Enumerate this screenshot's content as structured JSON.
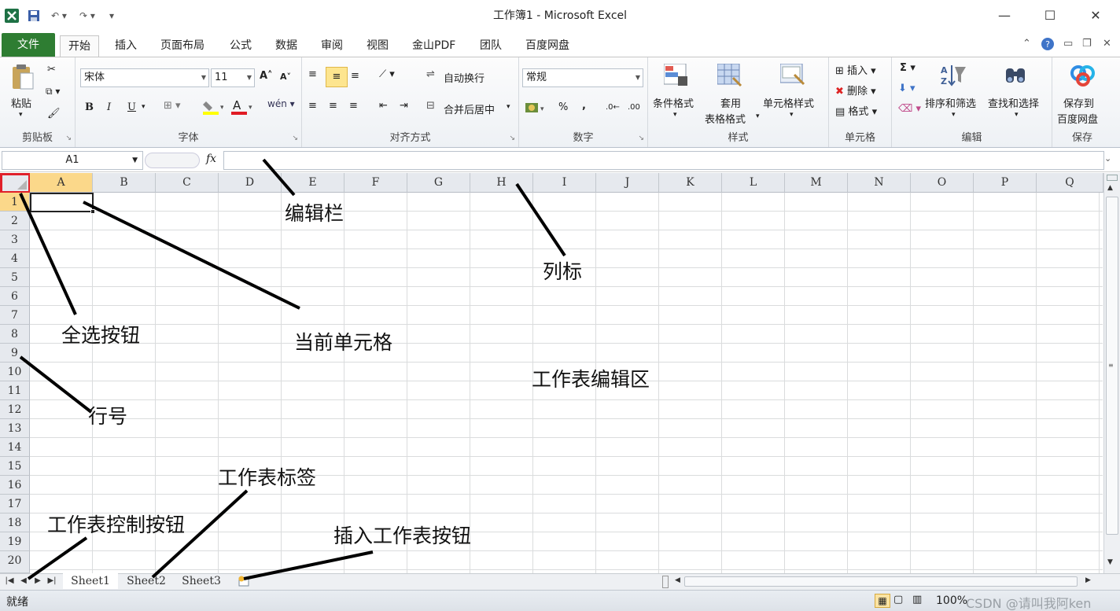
{
  "app": {
    "title": "工作簿1 - Microsoft Excel",
    "minimize_label": "—",
    "maximize_label": "☐",
    "close_label": "✕"
  },
  "tabs": [
    {
      "label": "文件"
    },
    {
      "label": "开始"
    },
    {
      "label": "插入"
    },
    {
      "label": "页面布局"
    },
    {
      "label": "公式"
    },
    {
      "label": "数据"
    },
    {
      "label": "审阅"
    },
    {
      "label": "视图"
    },
    {
      "label": "金山PDF"
    },
    {
      "label": "团队"
    },
    {
      "label": "百度网盘"
    }
  ],
  "ribbon": {
    "clipboard": {
      "label": "剪贴板",
      "paste": "粘贴"
    },
    "font": {
      "label": "字体",
      "name": "宋体",
      "size": "11",
      "bold": "B",
      "italic": "I",
      "underline": "U"
    },
    "alignment": {
      "label": "对齐方式",
      "wrap": "自动换行",
      "merge": "合并后居中"
    },
    "number": {
      "label": "数字",
      "format": "常规",
      "percent": "%",
      "comma": ","
    },
    "styles": {
      "label": "样式",
      "conditional": "条件格式",
      "table_line1": "套用",
      "table_line2": "表格格式",
      "cell_styles": "单元格样式"
    },
    "cells": {
      "label": "单元格",
      "insert": "插入",
      "delete": "删除",
      "format": "格式"
    },
    "editing": {
      "label": "编辑",
      "sort": "排序和筛选",
      "find": "查找和选择",
      "sigma": "Σ"
    },
    "save": {
      "label": "保存",
      "line1": "保存到",
      "line2": "百度网盘"
    }
  },
  "formula_bar": {
    "name_box": "A1",
    "fx": "fx",
    "value": ""
  },
  "columns": [
    "A",
    "B",
    "C",
    "D",
    "E",
    "F",
    "G",
    "H",
    "I",
    "J",
    "K",
    "L",
    "M",
    "N",
    "O",
    "P",
    "Q"
  ],
  "rows": [
    "1",
    "2",
    "3",
    "4",
    "5",
    "6",
    "7",
    "8",
    "9",
    "10",
    "11",
    "12",
    "13",
    "14",
    "15",
    "16",
    "17",
    "18",
    "19",
    "20"
  ],
  "sheets": [
    "Sheet1",
    "Sheet2",
    "Sheet3"
  ],
  "status": {
    "text": "就绪",
    "zoom": "100%",
    "watermark": "CSDN @请叫我阿ken"
  },
  "annotations": {
    "formula_bar": "编辑栏",
    "column_header": "列标",
    "select_all": "全选按钮",
    "current_cell": "当前单元格",
    "worksheet_area": "工作表编辑区",
    "row_number": "行号",
    "sheet_tabs": "工作表标签",
    "sheet_controls": "工作表控制按钮",
    "insert_sheet": "插入工作表按钮"
  },
  "colors": {
    "file_tab": "#2e7d32",
    "highlight": "#e0202a",
    "selected_header": "#fbd88a"
  }
}
